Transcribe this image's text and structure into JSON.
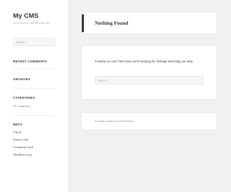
{
  "site": {
    "title": "My CMS",
    "description": "Just another WordPress site"
  },
  "sidebar": {
    "search_placeholder": "Search …",
    "recent_comments_title": "RECENT COMMENTS",
    "archives_title": "ARCHIVES",
    "categories_title": "CATEGORIES",
    "categories_empty": "No categories",
    "meta_title": "META",
    "meta_links": [
      "Log in",
      "Entries feed",
      "Comments feed",
      "WordPress.org"
    ]
  },
  "main": {
    "page_title": "Nothing Found",
    "message": "It seems we can't find what you're looking for. Perhaps searching can help.",
    "search_placeholder": "Search …"
  },
  "footer": {
    "credit": "Proudly powered by WordPress"
  },
  "colors": {
    "background": "#f1f1f1",
    "panel": "#ffffff",
    "accent_bar": "#333333"
  }
}
